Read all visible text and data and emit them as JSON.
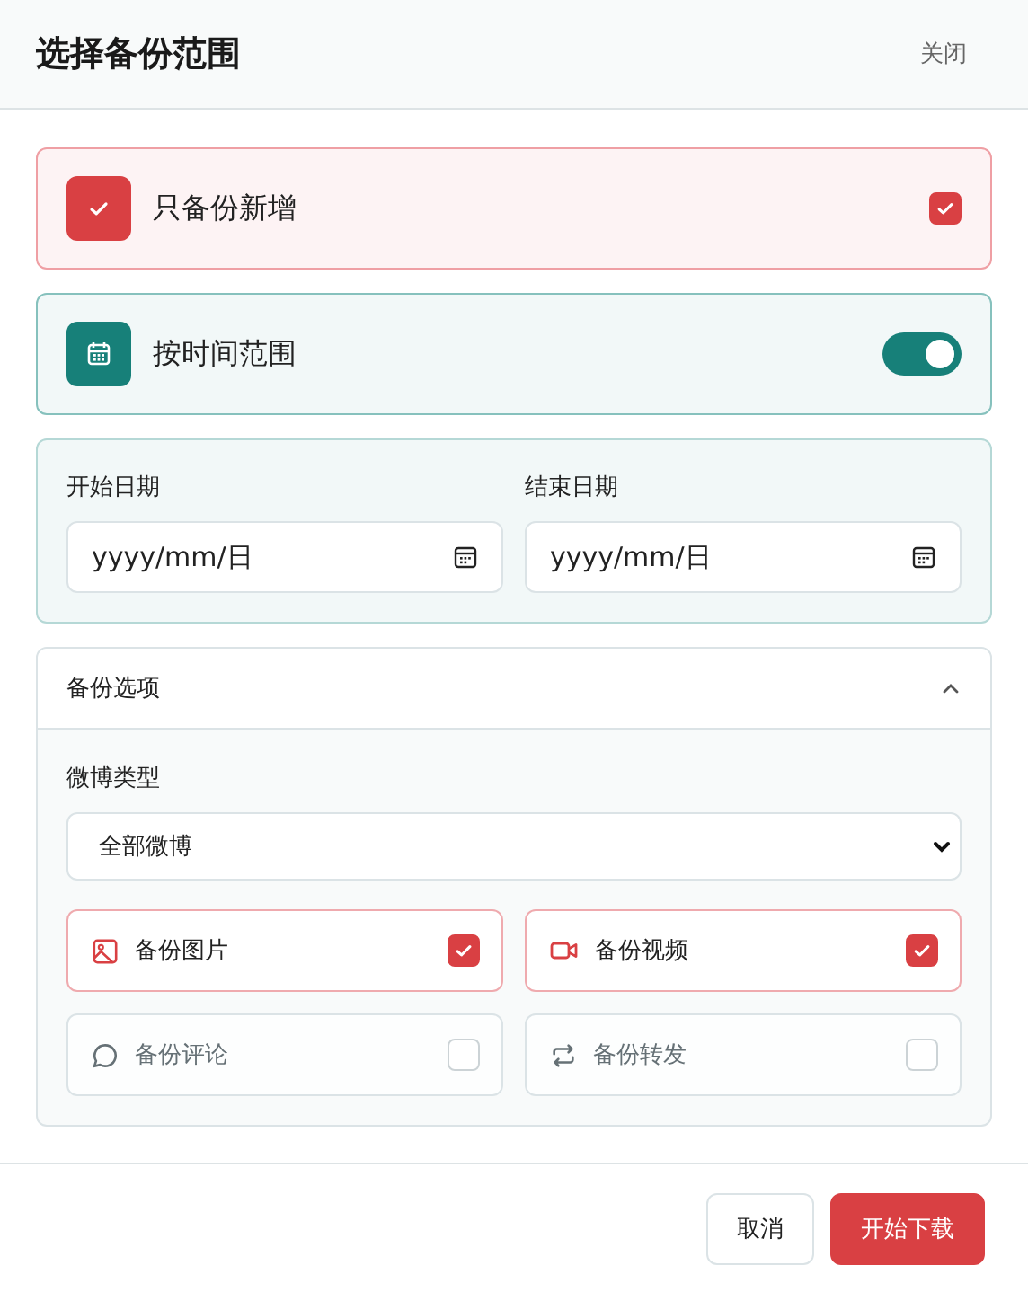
{
  "dialog": {
    "title": "选择备份范围",
    "close": "关闭"
  },
  "modes": [
    {
      "kind": "checkbox",
      "label": "只备份新增",
      "checked": true
    },
    {
      "kind": "toggle",
      "label": "按时间范围",
      "on": true
    }
  ],
  "date_range": {
    "fields": [
      {
        "label": "开始日期",
        "placeholder": "yyyy/mm/日"
      },
      {
        "label": "结束日期",
        "placeholder": "yyyy/mm/日"
      }
    ]
  },
  "options": {
    "title": "备份选项",
    "expanded": true,
    "type_label": "微博类型",
    "type_value": "全部微博",
    "items": [
      {
        "label": "备份图片",
        "checked": true
      },
      {
        "label": "备份视频",
        "checked": true
      },
      {
        "label": "备份评论",
        "checked": false
      },
      {
        "label": "备份转发",
        "checked": false
      }
    ]
  },
  "buttons": {
    "cancel": "取消",
    "confirm": "开始下载"
  }
}
